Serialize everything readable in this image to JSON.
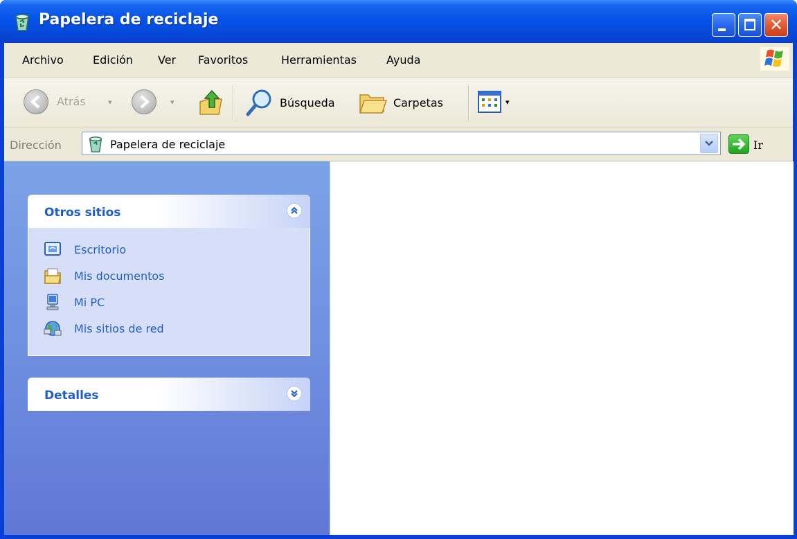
{
  "window": {
    "title": "Papelera de reciclaje",
    "title_icon": "recycle-bin-icon",
    "controls": [
      "minimize",
      "maximize",
      "close"
    ],
    "close_glyph": "✕"
  },
  "menu": {
    "items": [
      "Archivo",
      "Edición",
      "Ver",
      "Favoritos",
      "Herramientas",
      "Ayuda"
    ]
  },
  "toolbar": {
    "back_label": "Atrás",
    "search_label": "Búsqueda",
    "folders_label": "Carpetas",
    "icons": [
      "back-icon",
      "forward-icon",
      "up-folder-icon",
      "search-icon",
      "folders-icon",
      "views-icon"
    ]
  },
  "address": {
    "label": "Dirección",
    "value": "Papelera de reciclaje",
    "go_label": "Ir"
  },
  "left_pane": {
    "other_places": {
      "title": "Otros sitios",
      "expanded": true,
      "links": [
        {
          "label": "Escritorio",
          "icon": "desktop-icon"
        },
        {
          "label": "Mis documentos",
          "icon": "my-documents-icon"
        },
        {
          "label": "Mi PC",
          "icon": "my-computer-icon"
        },
        {
          "label": "Mis sitios de red",
          "icon": "network-places-icon"
        }
      ]
    },
    "details": {
      "title": "Detalles",
      "expanded": false
    }
  },
  "colors": {
    "title_bar": "#0553e8",
    "chrome": "#ece9d8",
    "task_pane": "#6f8fe0",
    "link": "#215dc6",
    "close_button": "#e45a32"
  }
}
